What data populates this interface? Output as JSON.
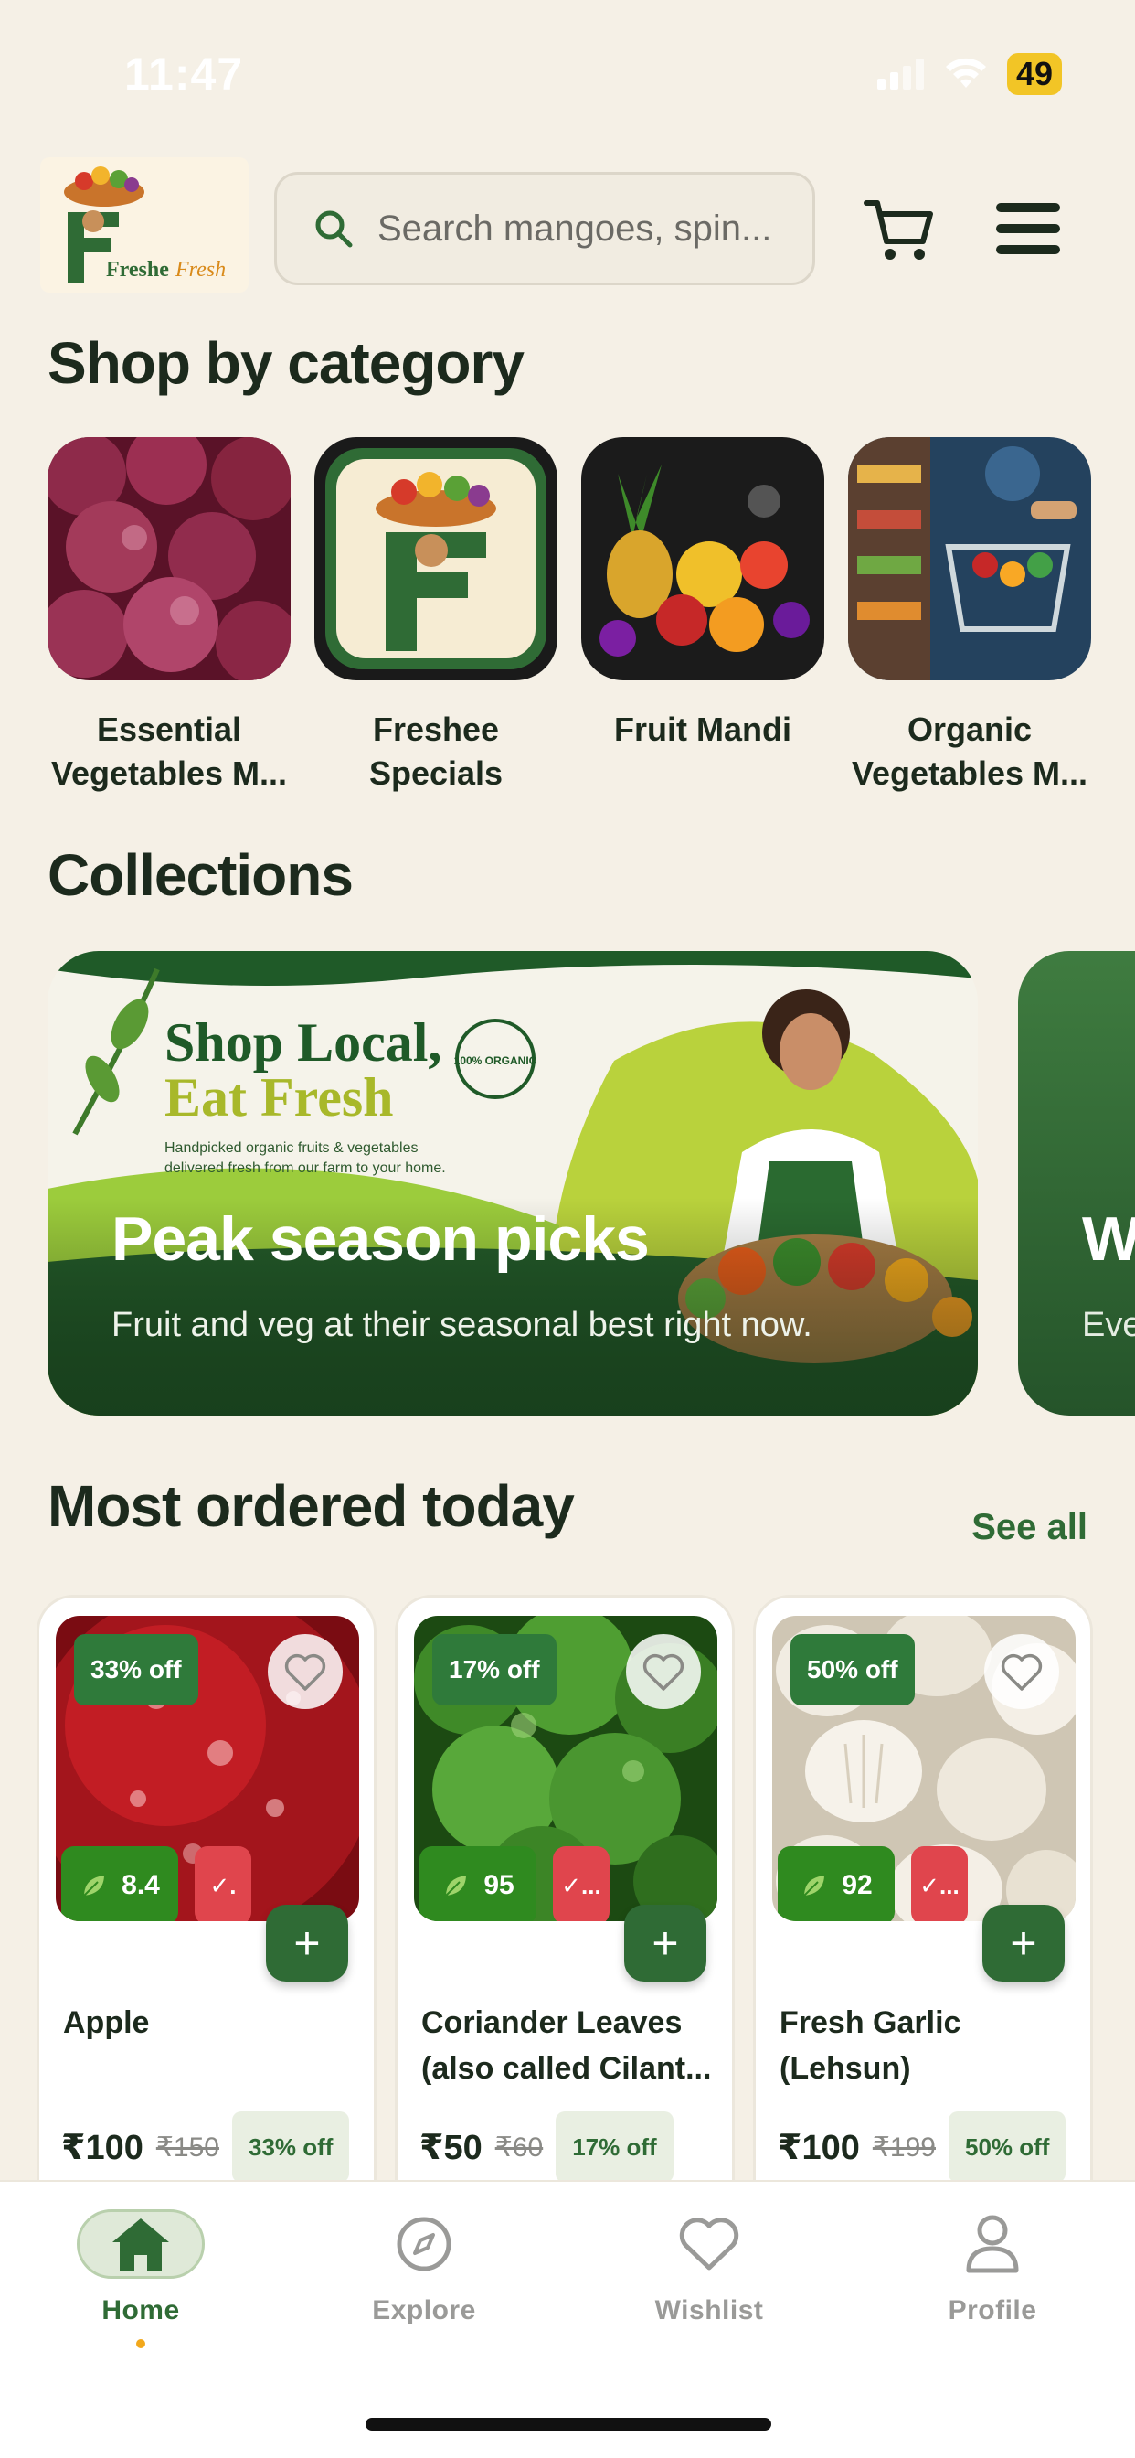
{
  "status": {
    "time": "11:47",
    "battery": "49"
  },
  "header": {
    "logo_text": "FresheéFresh",
    "search_placeholder": "Search mangoes, spin..."
  },
  "categories": {
    "title": "Shop by category",
    "items": [
      {
        "label": "Essential Vegetables M..."
      },
      {
        "label": "Freshee Specials"
      },
      {
        "label": "Fruit Mandi"
      },
      {
        "label": "Organic Vegetables M..."
      }
    ]
  },
  "collections": {
    "title": "Collections",
    "banners": [
      {
        "title": "Peak season picks",
        "subtitle": "Fruit and veg at their seasonal best right now."
      },
      {
        "title": "W",
        "subtitle": "Eve"
      }
    ],
    "banner_art": {
      "headline_1": "Shop Local,",
      "headline_2": "Eat Fresh",
      "tagline_1": "Handpicked organic fruits & vegetables",
      "tagline_2": "delivered fresh from our farm to your home.",
      "seal": "100% ORGANIC"
    }
  },
  "most_ordered": {
    "title": "Most ordered today",
    "see_all": "See all",
    "products": [
      {
        "name": "Apple",
        "discount": "33% off",
        "score": "8.4",
        "check": "✓.",
        "price": "₹100",
        "mrp": "₹150",
        "off": "33% off"
      },
      {
        "name": "Coriander Leaves (also called Cilant...",
        "discount": "17% off",
        "score": "95",
        "check": "✓...",
        "price": "₹50",
        "mrp": "₹60",
        "off": "17% off"
      },
      {
        "name": "Fresh Garlic (Lehsun)",
        "discount": "50% off",
        "score": "92",
        "check": "✓...",
        "price": "₹100",
        "mrp": "₹199",
        "off": "50% off"
      }
    ]
  },
  "nav": {
    "items": [
      {
        "label": "Home",
        "active": true
      },
      {
        "label": "Explore"
      },
      {
        "label": "Wishlist"
      },
      {
        "label": "Profile"
      }
    ]
  },
  "colors": {
    "brand_green": "#2f6b35",
    "background": "#f5f0e6",
    "score_green": "#2f8a1f",
    "check_red": "#e0454d",
    "accent_orange": "#f2a81c"
  }
}
